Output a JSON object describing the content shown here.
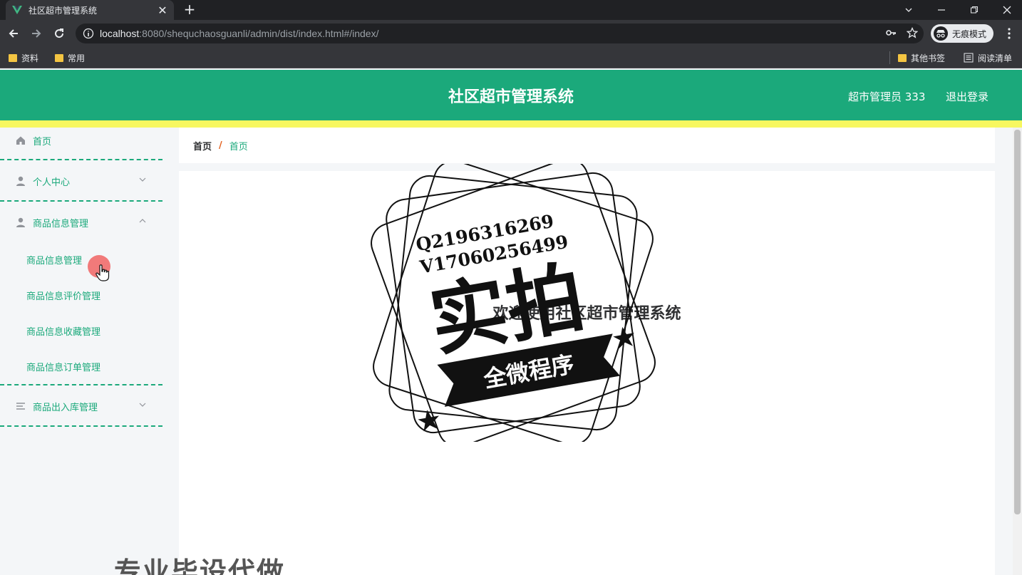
{
  "browser": {
    "tab_title": "社区超市管理系统",
    "url_host": "localhost",
    "url_rest": ":8080/shequchaosguanli/admin/dist/index.html#/index/",
    "incognito_label": "无痕模式",
    "bookmarks": [
      "资料",
      "常用"
    ],
    "bookmarks_right": [
      "其他书签",
      "阅读清单"
    ]
  },
  "header": {
    "title": "社区超市管理系统",
    "user": "超市管理员 333",
    "logout": "退出登录"
  },
  "sidebar": {
    "items": [
      {
        "label": "首页"
      },
      {
        "label": "个人中心"
      },
      {
        "label": "商品信息管理"
      },
      {
        "label": "商品出入库管理"
      }
    ],
    "sub_items": [
      "商品信息管理",
      "商品信息评价管理",
      "商品信息收藏管理",
      "商品信息订单管理"
    ]
  },
  "breadcrumb": {
    "home": "首页",
    "separator": "/",
    "current": "首页"
  },
  "main": {
    "welcome": "欢迎使用社区超市管理系统"
  },
  "watermark": {
    "line1": "Q2196316269",
    "line2": "V17060256499",
    "big": "实拍",
    "ribbon": "全微程序",
    "bottom": "专业毕设代做"
  },
  "colors": {
    "primary": "#1ba97b",
    "accent_bar": "#f7f760",
    "breadcrumb_separator": "#e2601d"
  }
}
